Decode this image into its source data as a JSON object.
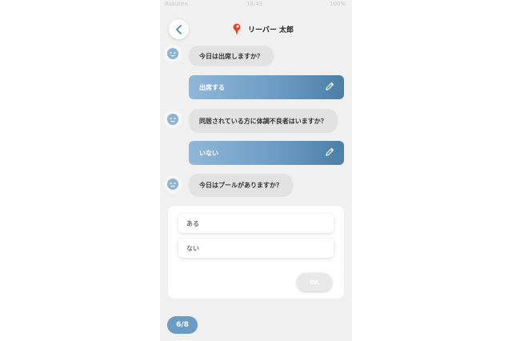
{
  "statusbar": {
    "carrier": "Rakuten",
    "time": "18:43",
    "battery": "100%"
  },
  "header": {
    "title": "リーバー 太郎",
    "back_icon": "chevron-left-icon",
    "logo_icon": "brand-logo-icon"
  },
  "conversation": {
    "q1": "今日は出席しますか？",
    "a1": "出席する",
    "q2": "同居されている方に体調不良者はいますか？",
    "a2": "いない",
    "q3": "今日はプールがありますか？"
  },
  "options_panel": {
    "options": [
      "ある",
      "ない"
    ],
    "ok_label": "OK"
  },
  "progress": {
    "label": "6/8"
  },
  "colors": {
    "accent": "#6b9cc5",
    "gradient_end": "#4c7fa6",
    "bubble": "#e2e2e2",
    "background": "#f0f0f0"
  }
}
